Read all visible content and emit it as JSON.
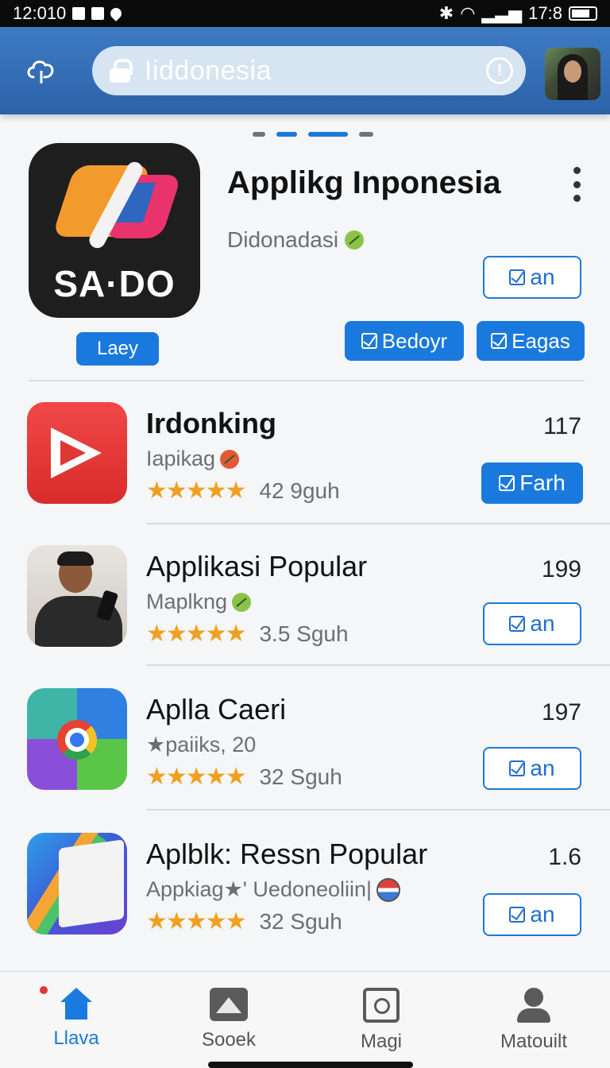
{
  "status_bar": {
    "time": "12:010",
    "battery": "17:8"
  },
  "search": {
    "value": "Iiddonesia"
  },
  "featured": {
    "brand": "SA·DO",
    "title": "Applikg Inponesia",
    "subtitle": "Didonadasi",
    "badge": "Laey",
    "action_label": "an",
    "buttons": [
      "Bedoyr",
      "Eagas"
    ]
  },
  "apps": [
    {
      "name": "Irdonking",
      "sub": "Iapikag",
      "rating": "42 9guh",
      "count": "117",
      "action": "Farh",
      "primary": true
    },
    {
      "name": "Applikasi Popular",
      "sub": "Maplkng",
      "rating": "3.5 Sguh",
      "count": "199",
      "action": "an",
      "primary": false
    },
    {
      "name": "Aplla Caeri",
      "sub": "★paiiks, 20",
      "rating": "32 Sguh",
      "count": "197",
      "action": "an",
      "primary": false
    },
    {
      "name": "Aplblk: Ressn Popular",
      "sub": "Appkiag★' Uedoneoliin|",
      "rating": "32 Sguh",
      "count": "1.6",
      "action": "an",
      "primary": false
    }
  ],
  "stars": "★★★★★",
  "bottom_nav": [
    {
      "label": "Llava",
      "icon": "home-icon",
      "active": true
    },
    {
      "label": "Sooek",
      "icon": "image-icon",
      "active": false
    },
    {
      "label": "Magi",
      "icon": "camera-icon",
      "active": false
    },
    {
      "label": "Matouilt",
      "icon": "person-icon",
      "active": false
    }
  ],
  "colors": {
    "header": "#2f67ad",
    "accent": "#1a79dc",
    "star": "#f0a020"
  }
}
